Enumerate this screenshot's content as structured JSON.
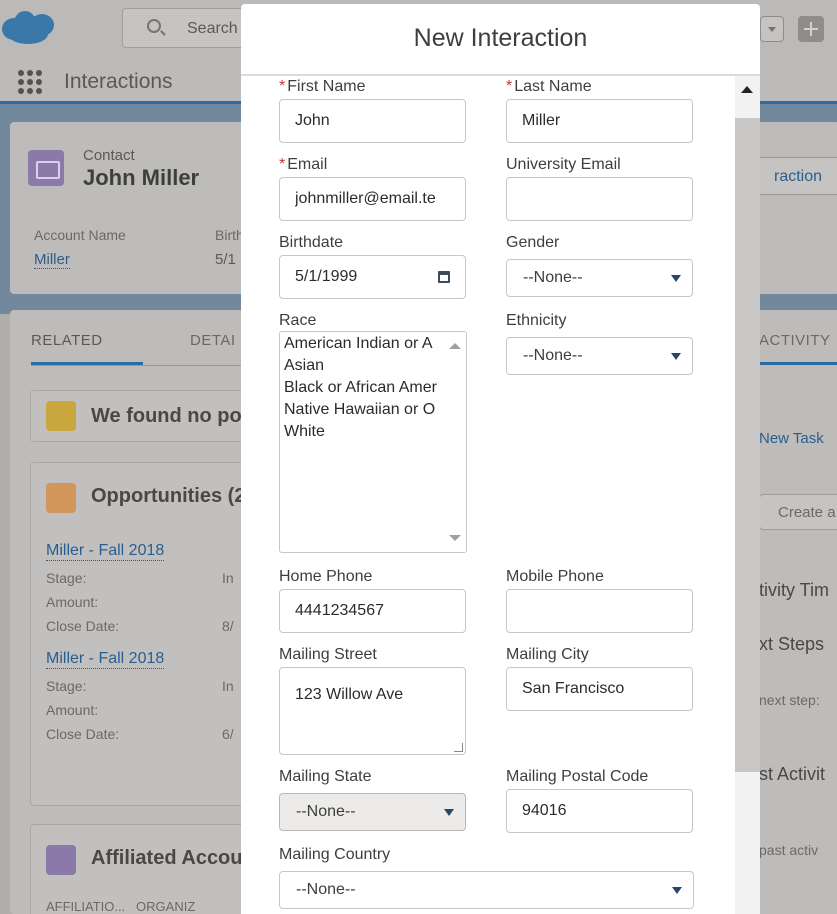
{
  "background": {
    "search_placeholder": "Search",
    "app_name": "Interactions",
    "record": {
      "type": "Contact",
      "name": "John Miller",
      "field1_label": "Account Name",
      "field1_value": "Miller",
      "field2_label": "Birth",
      "field2_value": "5/1",
      "button_label": "raction"
    },
    "tabs": {
      "related": "RELATED",
      "details": "DETAI",
      "activity": "ACTIVITY"
    },
    "cards": {
      "no_potential": "We found no po",
      "opportunities": "Opportunities (2",
      "affiliated": "Affiliated Accou",
      "affiliations_cols": "AFFILIATIO...   ORGANIZ"
    },
    "opportunities": [
      {
        "name": "Miller - Fall 2018",
        "stage_label": "Stage:",
        "stage_value": "In",
        "amount_label": "Amount:",
        "close_label": "Close Date:",
        "close_value": "8/"
      },
      {
        "name": "Miller - Fall 2018",
        "stage_label": "Stage:",
        "stage_value": "In",
        "amount_label": "Amount:",
        "close_label": "Close Date:",
        "close_value": "6/"
      }
    ],
    "activity": {
      "new_task": "New Task",
      "create": "Create a",
      "timeline": "tivity Tim",
      "next_steps": "xt Steps",
      "no_next": "next step:",
      "past": "st Activit",
      "no_past": "past activ"
    }
  },
  "modal": {
    "title": "New Interaction",
    "required_mark": "*",
    "fields": {
      "first_name": {
        "label": "First Name",
        "value": "John"
      },
      "last_name": {
        "label": "Last Name",
        "value": "Miller"
      },
      "email": {
        "label": "Email",
        "value": "johnmiller@email.te"
      },
      "university_email": {
        "label": "University Email",
        "value": ""
      },
      "birthdate": {
        "label": "Birthdate",
        "value": "5/1/1999"
      },
      "gender": {
        "label": "Gender",
        "value": "--None--"
      },
      "race": {
        "label": "Race",
        "options": [
          "American Indian or A",
          "Asian",
          "Black or African Amer",
          "Native Hawaiian or O",
          "White"
        ]
      },
      "ethnicity": {
        "label": "Ethnicity",
        "value": "--None--"
      },
      "home_phone": {
        "label": "Home Phone",
        "value": "4441234567"
      },
      "mobile_phone": {
        "label": "Mobile Phone",
        "value": ""
      },
      "mailing_street": {
        "label": "Mailing Street",
        "value": "123 Willow Ave"
      },
      "mailing_city": {
        "label": "Mailing City",
        "value": "San Francisco"
      },
      "mailing_state": {
        "label": "Mailing State",
        "value": "--None--"
      },
      "mailing_postal_code": {
        "label": "Mailing Postal Code",
        "value": "94016"
      },
      "mailing_country": {
        "label": "Mailing Country",
        "value": "--None--"
      }
    }
  }
}
